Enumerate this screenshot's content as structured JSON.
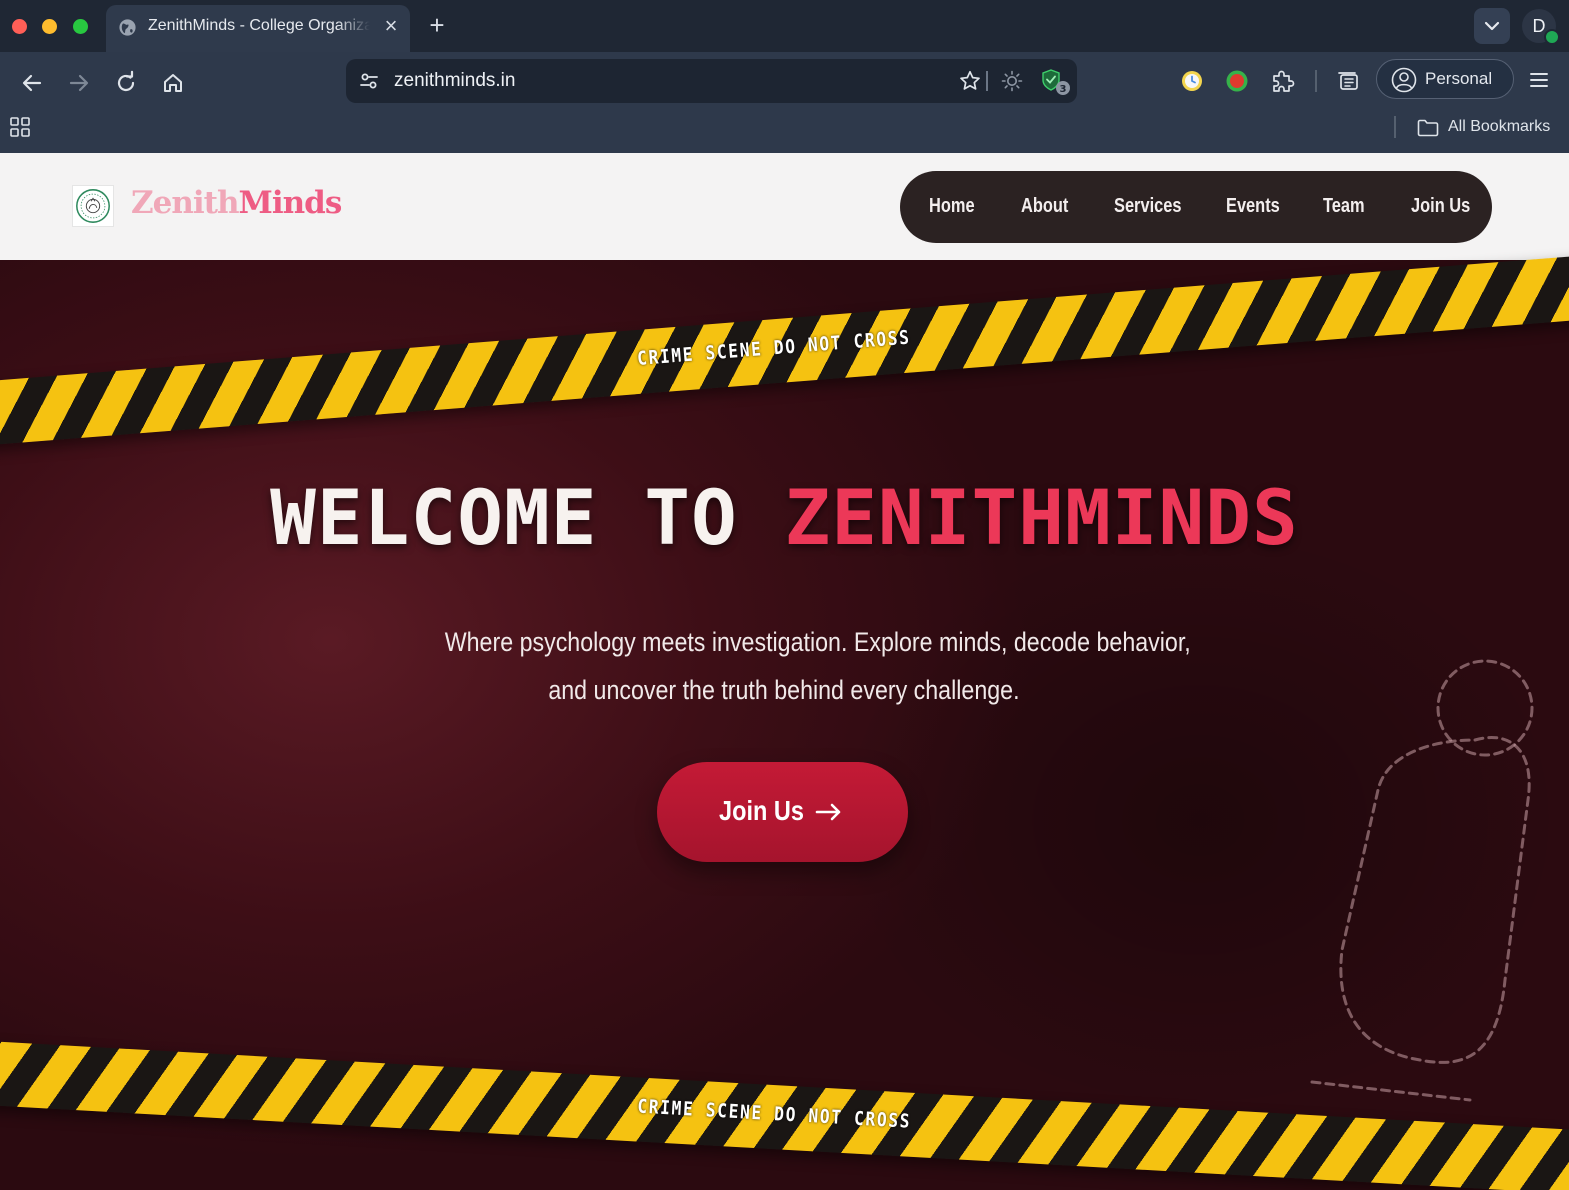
{
  "browser": {
    "tab_title": "ZenithMinds - College Organization",
    "url": "zenithminds.in",
    "shield_count": "3",
    "profile_initial": "D",
    "profile_label": "Personal",
    "bookmarks_label": "All Bookmarks"
  },
  "site": {
    "logo_part1": "Zenith",
    "logo_part2": "Minds",
    "nav": [
      "Home",
      "About",
      "Services",
      "Events",
      "Team",
      "Join Us"
    ]
  },
  "hero": {
    "tape_text": "CRIME SCENE DO NOT CROSS",
    "headline_part1": "WELCOME TO ",
    "headline_part2": "ZENITHMINDS",
    "subtitle_line1": "Where psychology meets investigation. Explore minds, decode behavior,",
    "subtitle_line2": "and uncover the truth behind every challenge.",
    "cta_label": "Join Us"
  },
  "colors": {
    "accent_red": "#ec3858",
    "cta_red": "#b8172f",
    "tape_yellow": "#f5c211",
    "hero_bg": "#3d0e16",
    "nav_bg": "#2b2222"
  },
  "icons": [
    "globe-icon",
    "close-icon",
    "plus-icon",
    "chevron-down-icon",
    "back-arrow-icon",
    "forward-arrow-icon",
    "reload-icon",
    "home-icon",
    "tune-icon",
    "star-icon",
    "sun-icon",
    "shield-icon",
    "puzzle-icon",
    "reading-list-icon",
    "user-circle-icon",
    "menu-icon",
    "apps-grid-icon",
    "folder-icon",
    "arrow-right-icon"
  ]
}
